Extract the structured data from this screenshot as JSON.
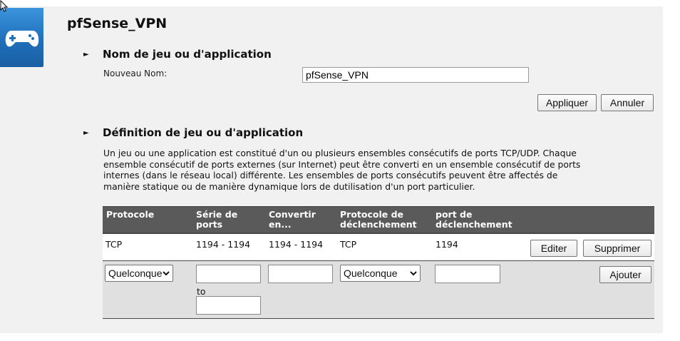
{
  "app_icon": "gamepad-icon",
  "page_title": "pfSense_VPN",
  "section_name": {
    "title": "Nom de jeu ou d'application",
    "field_label": "Nouveau Nom:",
    "field_value": "pfSense_VPN",
    "apply_label": "Appliquer",
    "cancel_label": "Annuler"
  },
  "section_definition": {
    "title": "Définition de jeu ou d'application",
    "description_lines": [
      "Un jeu ou une application est constitué d'un ou plusieurs ensembles consécutifs de ports TCP/UDP. Chaque",
      "ensemble consécutif de ports externes (sur Internet) peut être converti en un ensemble consécutif de ports",
      "internes (dans le réseau local) différente. Les ensembles de ports consécutifs peuvent être affectés de",
      "manière statique ou de manière dynamique lors de dutilisation d'un port particulier."
    ],
    "table": {
      "headers": {
        "protocol": [
          "Protocole"
        ],
        "port_range": [
          "Série de",
          "ports"
        ],
        "convert": [
          "Convertir",
          "en..."
        ],
        "trigger_protocol": [
          "Protocole de",
          "déclenchement"
        ],
        "trigger_port": [
          "port de",
          "déclenchement"
        ]
      },
      "rows": [
        {
          "protocol": "TCP",
          "port_range": "1194 - 1194",
          "convert": "1194 - 1194",
          "trigger_protocol": "TCP",
          "trigger_port": "1194",
          "edit_label": "Editer",
          "delete_label": "Supprimer"
        }
      ],
      "new_row": {
        "protocol_selected": "Quelconque",
        "port_from": "",
        "to_label": "to",
        "port_to": "",
        "convert": "",
        "trigger_protocol_selected": "Quelconque",
        "trigger_port": "",
        "add_label": "Ajouter"
      }
    }
  }
}
